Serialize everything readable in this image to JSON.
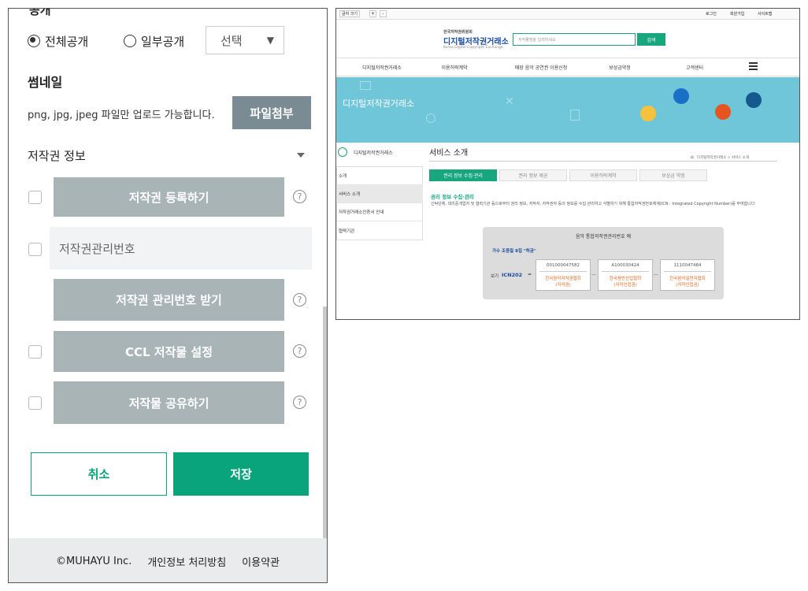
{
  "left": {
    "top_cut_label": "공개",
    "visibility": {
      "option_all": "전체공개",
      "option_partial": "일부공개",
      "select_value": "선택",
      "select_arrow": "▼"
    },
    "thumbnail": {
      "title": "썸네일",
      "hint": "png, jpg, jpeg 파일만 업로드 가능합니다.",
      "attach_label": "파일첨부"
    },
    "copyright": {
      "title": "저작권 정보",
      "register_label": "저작권 등록하기",
      "number_placeholder": "저작권관리번호",
      "get_number_label": "저작권 관리번호 받기",
      "ccl_label": "CCL 저작물 설정",
      "share_label": "저작물 공유하기",
      "help_glyph": "?"
    },
    "actions": {
      "cancel_label": "취소",
      "save_label": "저장"
    },
    "footer": {
      "copyright": "©MUHAYU Inc.",
      "privacy": "개인정보 처리방침",
      "terms": "이용약관"
    },
    "colors": {
      "primary": "#0aa47c",
      "gray_button": "#a9b4b6"
    }
  },
  "right": {
    "topbar": {
      "font_size": "글자 크기",
      "plus": "+",
      "minus": "-",
      "login": "로그인",
      "signup": "회원가입",
      "sitemap": "사이트맵"
    },
    "logo": {
      "org": "한국저작권위원회",
      "name": "디지털저작권거래소",
      "english": "Korea Digital Copyright Exchange"
    },
    "search": {
      "placeholder": "저작물명을 입력하세요",
      "button": "검색"
    },
    "nav": [
      "디지털저작권거래소",
      "이용허락계약",
      "매장 음악 공연권 이용신청",
      "보상금약정",
      "고객센터"
    ],
    "banner_title": "디지털저작권거래소",
    "side": {
      "title": "디지털저작권거래소",
      "items": [
        "소개",
        "서비스 소개",
        "저작권거래소인증서 안내",
        "협력기관"
      ]
    },
    "content": {
      "title": "서비스 소개",
      "breadcrumb": "디지털저작권거래소 > 서비스 소개",
      "tabs": [
        "권리 정보 수집·관리",
        "권리 정보 제공",
        "이용허락계약",
        "보상금 약정"
      ],
      "section_title": "권리 정보 수집·관리",
      "description": "신탁단체, 대리중개업자 및 협력기관 등으로부터 권리 정보, 저작자, 저작권자 등의 정보를 수집 관리하고 식별하기 위해 통합저작권번호체계(ICN : Integrated Copyright Number)를 부여합니다",
      "example": {
        "title": "음악 통합저작권관리번호 예",
        "song": "가수 조용필 8집 \"허공\"",
        "example_label": "보기",
        "icn": "ICN202",
        "eq": "=",
        "dash": "—",
        "codes": [
          {
            "number": "001000047582",
            "org": "한국음악저작권협회",
            "role": "(저작권)"
          },
          {
            "number": "A100030424",
            "org": "한국음반산업협회",
            "role": "(저작인접권)"
          },
          {
            "number": "1110047484",
            "org": "한국음악실연자협회",
            "role": "(저작인접권)"
          }
        ]
      }
    },
    "colors": {
      "accent": "#17a67e",
      "banner": "#6fc6d8",
      "blue": "#1a4aa1"
    }
  }
}
